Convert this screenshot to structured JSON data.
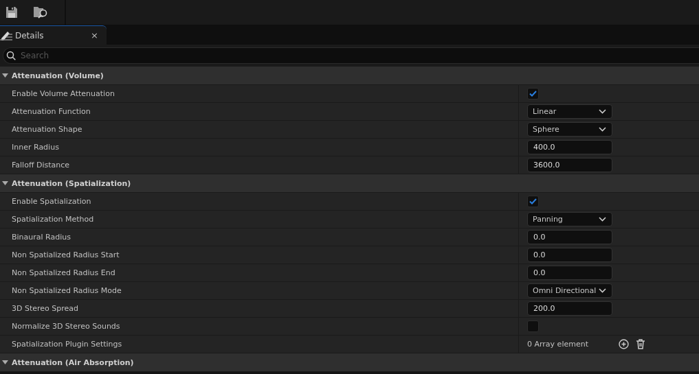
{
  "toolbar": {
    "buttons": [
      {
        "kind": "save"
      },
      {
        "kind": "browse"
      }
    ]
  },
  "tabs": [
    {
      "label": "Details",
      "selected": true,
      "close": "×"
    }
  ],
  "search": {
    "placeholder": "Search"
  },
  "sections": [
    {
      "title": "Attenuation (Volume)",
      "expanded": true,
      "rows": [
        {
          "label": "Enable Volume Attenuation",
          "kind": "checkbox",
          "checked": true
        },
        {
          "label": "Attenuation Function",
          "kind": "dropdown",
          "value": "Linear"
        },
        {
          "label": "Attenuation Shape",
          "kind": "dropdown",
          "value": "Sphere"
        },
        {
          "label": "Inner Radius",
          "kind": "number",
          "value": "400.0"
        },
        {
          "label": "Falloff Distance",
          "kind": "number",
          "value": "3600.0"
        }
      ]
    },
    {
      "title": "Attenuation (Spatialization)",
      "expanded": true,
      "rows": [
        {
          "label": "Enable Spatialization",
          "kind": "checkbox",
          "checked": true
        },
        {
          "label": "Spatialization Method",
          "kind": "dropdown",
          "value": "Panning"
        },
        {
          "label": "Binaural Radius",
          "kind": "number",
          "value": "0.0"
        },
        {
          "label": "Non Spatialized Radius Start",
          "kind": "number",
          "value": "0.0"
        },
        {
          "label": "Non Spatialized Radius End",
          "kind": "number",
          "value": "0.0"
        },
        {
          "label": "Non Spatialized Radius Mode",
          "kind": "dropdown",
          "value": "Omni Directional"
        },
        {
          "label": "3D Stereo Spread",
          "kind": "number",
          "value": "200.0"
        },
        {
          "label": "Normalize 3D Stereo Sounds",
          "kind": "checkbox",
          "checked": false
        },
        {
          "label": "Spatialization Plugin Settings",
          "kind": "array",
          "value": "0 Array element"
        }
      ]
    },
    {
      "title": "Attenuation (Air Absorption)",
      "expanded": true
    }
  ]
}
